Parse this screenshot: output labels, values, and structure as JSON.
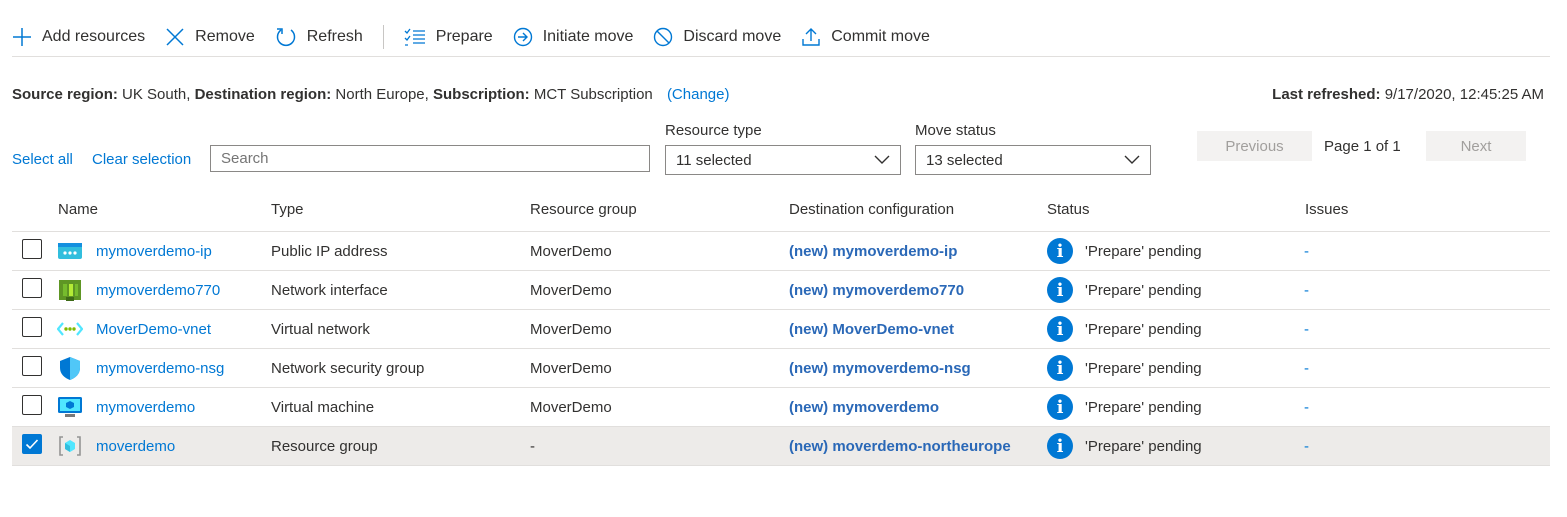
{
  "toolbar": {
    "add_resources": "Add resources",
    "remove": "Remove",
    "refresh": "Refresh",
    "prepare": "Prepare",
    "initiate_move": "Initiate move",
    "discard_move": "Discard move",
    "commit_move": "Commit move"
  },
  "info": {
    "source_label": "Source region:",
    "source_value": "UK South,",
    "dest_label": "Destination region:",
    "dest_value": "North Europe,",
    "sub_label": "Subscription:",
    "sub_value": "MCT Subscription",
    "change": "(Change)",
    "refreshed_label": "Last refreshed:",
    "refreshed_value": "9/17/2020, 12:45:25 AM"
  },
  "filters": {
    "select_all": "Select all",
    "clear_selection": "Clear selection",
    "search_placeholder": "Search",
    "resource_type_label": "Resource type",
    "resource_type_value": "11 selected",
    "move_status_label": "Move status",
    "move_status_value": "13 selected"
  },
  "pager": {
    "previous": "Previous",
    "page": "Page 1 of 1",
    "next": "Next"
  },
  "columns": {
    "name": "Name",
    "type": "Type",
    "group": "Resource group",
    "dest": "Destination configuration",
    "status": "Status",
    "issues": "Issues"
  },
  "rows": [
    {
      "name": "mymoverdemo-ip",
      "type": "Public IP address",
      "group": "MoverDemo",
      "dest": "(new) mymoverdemo-ip",
      "status": "'Prepare' pending",
      "issues": "-",
      "icon": "public-ip-icon",
      "checked": false
    },
    {
      "name": "mymoverdemo770",
      "type": "Network interface",
      "group": "MoverDemo",
      "dest": "(new) mymoverdemo770",
      "status": "'Prepare' pending",
      "issues": "-",
      "icon": "network-interface-icon",
      "checked": false
    },
    {
      "name": "MoverDemo-vnet",
      "type": "Virtual network",
      "group": "MoverDemo",
      "dest": "(new) MoverDemo-vnet",
      "status": "'Prepare' pending",
      "issues": "-",
      "icon": "virtual-network-icon",
      "checked": false
    },
    {
      "name": "mymoverdemo-nsg",
      "type": "Network security group",
      "group": "MoverDemo",
      "dest": "(new) mymoverdemo-nsg",
      "status": "'Prepare' pending",
      "issues": "-",
      "icon": "nsg-shield-icon",
      "checked": false
    },
    {
      "name": "mymoverdemo",
      "type": "Virtual machine",
      "group": "MoverDemo",
      "dest": "(new) mymoverdemo",
      "status": "'Prepare' pending",
      "issues": "-",
      "icon": "virtual-machine-icon",
      "checked": false
    },
    {
      "name": "moverdemo",
      "type": "Resource group",
      "group": "-",
      "dest": "(new) moverdemo-northeurope",
      "status": "'Prepare' pending",
      "issues": "-",
      "icon": "resource-group-icon",
      "checked": true
    }
  ],
  "colors": {
    "accent": "#0078d4",
    "dest_text": "#2a68b7",
    "selected_row": "#edebe9"
  }
}
